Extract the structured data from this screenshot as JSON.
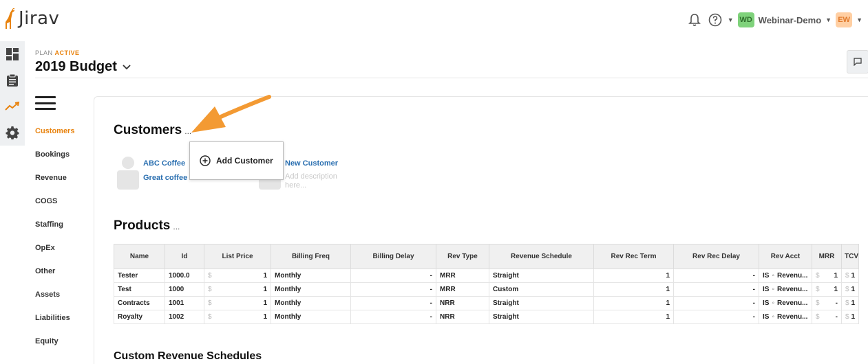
{
  "app": {
    "logo_text": "Jirav"
  },
  "topbar": {
    "workspace": "Webinar-Demo",
    "workspace_initials": "WD",
    "user_initials": "EW",
    "colors": {
      "workspace_avatar": "#7fd27b",
      "user_avatar": "#ffcfa3"
    }
  },
  "rail": {
    "icons": [
      "dashboard-icon",
      "clipboard-icon",
      "trend-icon",
      "gear-icon"
    ]
  },
  "plan": {
    "label": "PLAN",
    "status": "ACTIVE",
    "title": "2019 Budget"
  },
  "nav": {
    "items": [
      "Customers",
      "Bookings",
      "Revenue",
      "COGS",
      "Staffing",
      "OpEx",
      "Other",
      "Assets",
      "Liabilities",
      "Equity"
    ],
    "active": "Customers"
  },
  "customers": {
    "title": "Customers",
    "dots": "...",
    "cards": [
      {
        "name": "ABC Coffee",
        "description": "Great coffee"
      },
      {
        "name": "New Customer",
        "description": "Add description here..."
      }
    ],
    "popover": {
      "label": "Add Customer"
    }
  },
  "products": {
    "title": "Products",
    "dots": "...",
    "columns": [
      "Name",
      "Id",
      "List Price",
      "Billing Freq",
      "Billing Delay",
      "Rev Type",
      "Revenue Schedule",
      "Rev Rec Term",
      "Rev Rec Delay",
      "Rev Acct",
      "MRR",
      "TCV"
    ],
    "rows": [
      {
        "name": "Tester",
        "id": "1000.0",
        "list_price": "1",
        "billing_freq": "Monthly",
        "billing_delay": "-",
        "rev_type": "MRR",
        "schedule": "Straight",
        "term": "1",
        "delay": "-",
        "acct_type": "IS",
        "acct": "Revenu...",
        "mrr": "1",
        "tcv": "1"
      },
      {
        "name": "Test",
        "id": "1000",
        "list_price": "1",
        "billing_freq": "Monthly",
        "billing_delay": "-",
        "rev_type": "MRR",
        "schedule": "Custom",
        "term": "1",
        "delay": "-",
        "acct_type": "IS",
        "acct": "Revenu...",
        "mrr": "1",
        "tcv": "1"
      },
      {
        "name": "Contracts",
        "id": "1001",
        "list_price": "1",
        "billing_freq": "Monthly",
        "billing_delay": "-",
        "rev_type": "NRR",
        "schedule": "Straight",
        "term": "1",
        "delay": "-",
        "acct_type": "IS",
        "acct": "Revenu...",
        "mrr": "-",
        "tcv": "1"
      },
      {
        "name": "Royalty",
        "id": "1002",
        "list_price": "1",
        "billing_freq": "Monthly",
        "billing_delay": "-",
        "rev_type": "NRR",
        "schedule": "Straight",
        "term": "1",
        "delay": "-",
        "acct_type": "IS",
        "acct": "Revenu...",
        "mrr": "-",
        "tcv": "1"
      }
    ],
    "currency_symbol": "$"
  },
  "custom_schedules": {
    "title": "Custom Revenue Schedules"
  }
}
